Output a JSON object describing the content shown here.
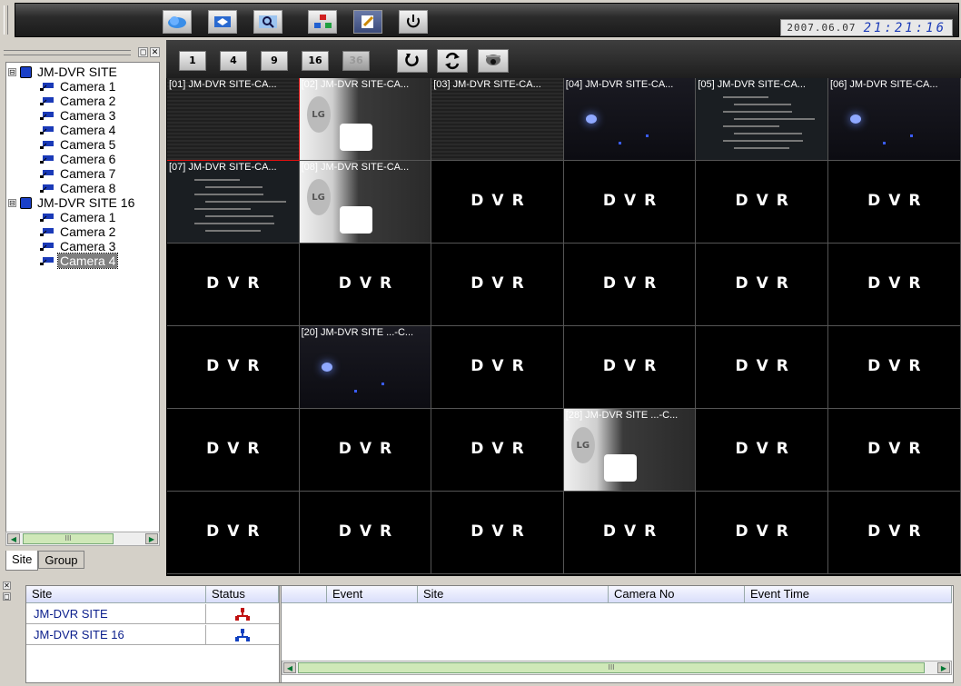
{
  "toolbar": {
    "buttons": [
      {
        "name": "connect-button",
        "icon": "cloud-icon"
      },
      {
        "name": "setup-button",
        "icon": "settings-icon"
      },
      {
        "name": "search-button",
        "icon": "search-icon"
      },
      {
        "name": "network-button",
        "icon": "network-icon"
      },
      {
        "name": "edit-button",
        "icon": "edit-icon"
      },
      {
        "name": "power-button",
        "icon": "power-icon"
      }
    ],
    "date": "2007.06.07",
    "time": "21:21:16"
  },
  "tree": {
    "sites": [
      {
        "label": "JM-DVR SITE",
        "cameras": [
          "Camera 1",
          "Camera 2",
          "Camera 3",
          "Camera 4",
          "Camera 5",
          "Camera 6",
          "Camera 7",
          "Camera 8"
        ]
      },
      {
        "label": "JM-DVR SITE 16",
        "cameras": [
          "Camera 1",
          "Camera 2",
          "Camera 3",
          "Camera 4"
        ]
      }
    ],
    "selected": "Camera 4",
    "expand_symbol": "⊟",
    "scroll_left": "◀",
    "scroll_thumb": "III",
    "scroll_right": "▶"
  },
  "tabs": {
    "site": "Site",
    "group": "Group"
  },
  "view": {
    "layout_buttons": [
      "1",
      "4",
      "9",
      "16",
      "36"
    ],
    "disabled_layout": "36",
    "icon_buttons": [
      "refresh-icon",
      "swap-icon",
      "dome-camera-icon"
    ],
    "placeholder": "DVR",
    "cells": [
      {
        "index": 0,
        "title": "[01] JM-DVR SITE-CA...",
        "feed": "noise",
        "selected": true
      },
      {
        "index": 1,
        "title": "[02] JM-DVR SITE-CA...",
        "feed": "lg"
      },
      {
        "index": 2,
        "title": "[03] JM-DVR SITE-CA...",
        "feed": "noise"
      },
      {
        "index": 3,
        "title": "[04] JM-DVR SITE-CA...",
        "feed": "night"
      },
      {
        "index": 4,
        "title": "[05] JM-DVR SITE-CA...",
        "feed": "text"
      },
      {
        "index": 5,
        "title": "[06] JM-DVR SITE-CA...",
        "feed": "night"
      },
      {
        "index": 6,
        "title": "[07] JM-DVR SITE-CA...",
        "feed": "text"
      },
      {
        "index": 7,
        "title": "[08] JM-DVR SITE-CA...",
        "feed": "lg"
      },
      {
        "index": 19,
        "title": "[20] JM-DVR SITE ...-C...",
        "feed": "night"
      },
      {
        "index": 27,
        "title": "[28] JM-DVR SITE ...-C...",
        "feed": "lg"
      }
    ]
  },
  "bottom": {
    "site_headers": [
      "Site",
      "Status"
    ],
    "sites": [
      {
        "name": "JM-DVR SITE",
        "status_icon": "network-status-red-icon",
        "status_color": "#c01010"
      },
      {
        "name": "JM-DVR SITE 16",
        "status_icon": "network-status-blue-icon",
        "status_color": "#1040c0"
      }
    ],
    "event_headers": [
      "",
      "Event",
      "Site",
      "Camera No",
      "Event Time"
    ],
    "pin_symbol": "✕",
    "restore_symbol": "◻",
    "scroll_left": "◀",
    "scroll_thumb": "III",
    "scroll_right": "▶"
  }
}
